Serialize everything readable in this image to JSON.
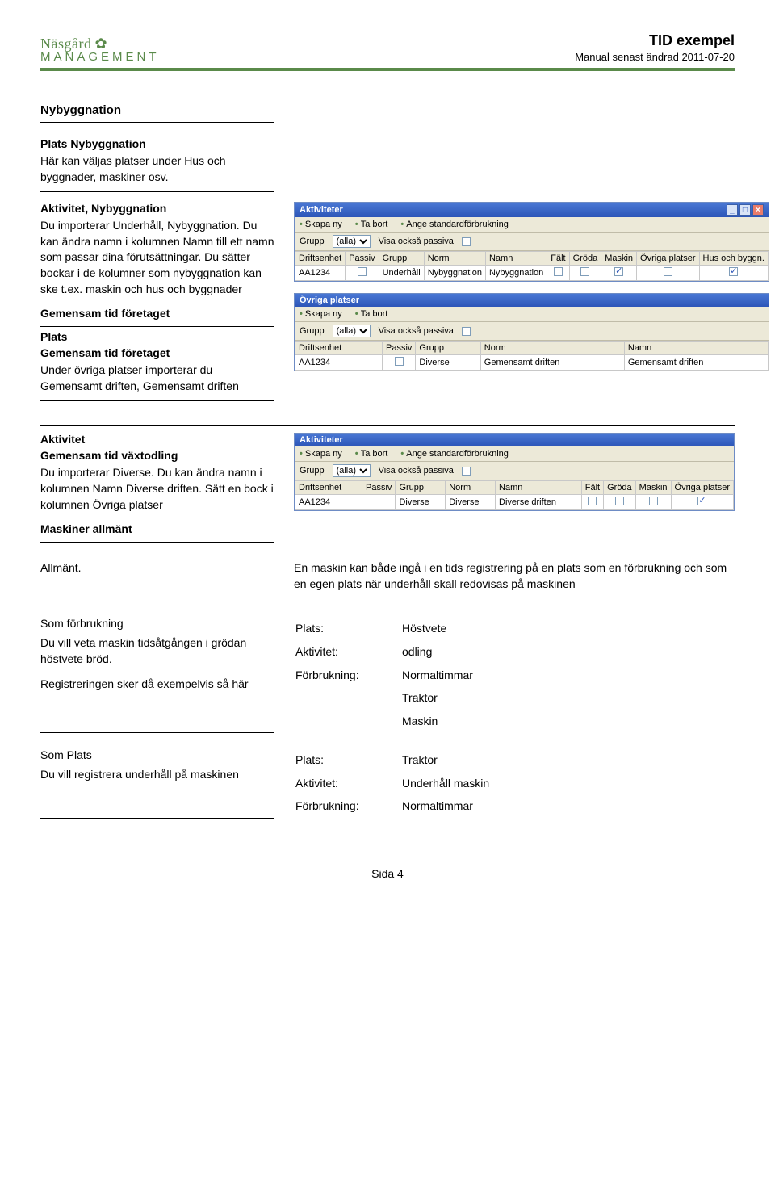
{
  "header": {
    "logo_top": "Näsgård",
    "logo_bottom": "MANAGEMENT",
    "title": "TID exempel",
    "subtitle": "Manual senast ändrad 2011-07-20"
  },
  "sec1": {
    "heading": "Nybyggnation",
    "sub_heading": "Plats Nybyggnation",
    "para": "Här kan väljas platser under Hus och byggnader, maskiner osv."
  },
  "sec2": {
    "sub_heading": "Aktivitet, Nybyggnation",
    "para": "Du importerar Underhåll, Nybyggnation. Du kan ändra namn i kolumnen Namn till ett namn som passar dina förutsättningar. Du sätter bockar i de kolumner som nybyggnation kan ske t.ex. maskin och hus och byggnader",
    "sub2": "Gemensam tid företaget"
  },
  "sec3": {
    "sub_heading": "Plats",
    "sub2": "Gemensam tid företaget",
    "para": "Under övriga platser importerar du Gemensamt driften, Gemensamt driften"
  },
  "sec4": {
    "sub_heading": "Aktivitet",
    "sub2": "Gemensam tid växtodling",
    "para": "Du importerar Diverse. Du kan ändra namn i kolumnen Namn Diverse driften. Sätt en bock i kolumnen Övriga platser",
    "sub3": "Maskiner allmänt"
  },
  "sec5": {
    "left": "Allmänt.",
    "right": "En maskin kan både ingå i en tids registrering på en plats som en förbrukning och som en egen plats när underhåll skall redovisas på maskinen"
  },
  "sec6": {
    "left_head": "Som förbrukning",
    "left_para1": "Du vill veta maskin tidsåtgången i grödan höstvete bröd.",
    "left_para2": "Registreringen sker då exempelvis så här",
    "rows": [
      [
        "Plats:",
        "Höstvete"
      ],
      [
        "Aktivitet:",
        "odling"
      ],
      [
        "Förbrukning:",
        "Normaltimmar"
      ],
      [
        "",
        "Traktor"
      ],
      [
        "",
        "Maskin"
      ]
    ]
  },
  "sec7": {
    "left_head": "Som Plats",
    "left_para": "Du vill registrera underhåll på maskinen",
    "rows": [
      [
        "Plats:",
        "Traktor"
      ],
      [
        "Aktivitet:",
        "Underhåll maskin"
      ],
      [
        "Förbrukning:",
        "Normaltimmar"
      ]
    ]
  },
  "win1": {
    "title": "Aktiviteter",
    "tb": [
      "Skapa ny",
      "Ta bort",
      "Ange standardförbrukning"
    ],
    "filter_label": "Grupp",
    "filter_value": "(alla)",
    "filter2": "Visa också passiva",
    "cols": [
      "Driftsenhet",
      "Passiv",
      "Grupp",
      "Norm",
      "Namn",
      "Fält",
      "Gröda",
      "Maskin",
      "Övriga platser",
      "Hus och byggn."
    ],
    "row": [
      "AA1234",
      "",
      "Underhåll",
      "Nybyggnation",
      "Nybyggnation",
      "",
      "",
      "on",
      "",
      "on"
    ]
  },
  "win2": {
    "title": "Övriga platser",
    "tb": [
      "Skapa ny",
      "Ta bort"
    ],
    "filter_label": "Grupp",
    "filter_value": "(alla)",
    "filter2": "Visa också passiva",
    "cols": [
      "Driftsenhet",
      "Passiv",
      "Grupp",
      "Norm",
      "Namn"
    ],
    "row": [
      "AA1234",
      "",
      "Diverse",
      "Gemensamt driften",
      "Gemensamt driften"
    ]
  },
  "win3": {
    "title": "Aktiviteter",
    "tb": [
      "Skapa ny",
      "Ta bort",
      "Ange standardförbrukning"
    ],
    "filter_label": "Grupp",
    "filter_value": "(alla)",
    "filter2": "Visa också passiva",
    "cols": [
      "Driftsenhet",
      "Passiv",
      "Grupp",
      "Norm",
      "Namn",
      "Fält",
      "Gröda",
      "Maskin",
      "Övriga platser"
    ],
    "row": [
      "AA1234",
      "",
      "Diverse",
      "Diverse",
      "Diverse driften",
      "",
      "",
      "",
      "on"
    ]
  },
  "footer": "Sida 4"
}
